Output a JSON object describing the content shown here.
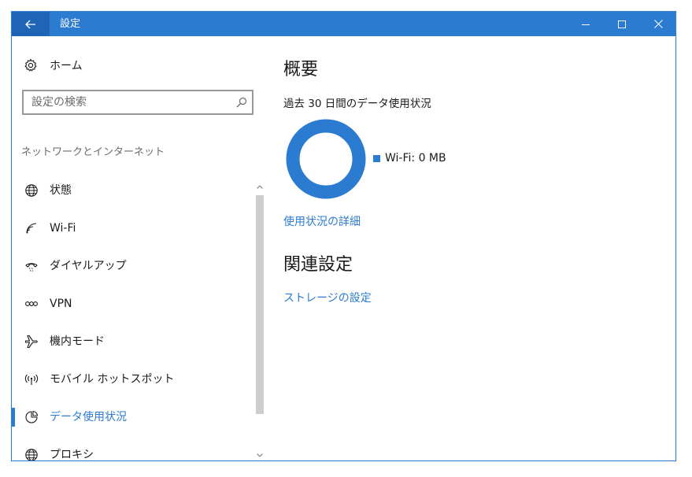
{
  "window": {
    "title": "設定",
    "accent_color": "#2b7bd0"
  },
  "sidebar": {
    "home_label": "ホーム",
    "search_placeholder": "設定の検索",
    "section_label": "ネットワークとインターネット",
    "items": [
      {
        "label": "状態",
        "icon": "globe-status-icon"
      },
      {
        "label": "Wi-Fi",
        "icon": "wifi-icon"
      },
      {
        "label": "ダイヤルアップ",
        "icon": "dialup-icon"
      },
      {
        "label": "VPN",
        "icon": "vpn-icon"
      },
      {
        "label": "機内モード",
        "icon": "airplane-icon"
      },
      {
        "label": "モバイル ホットスポット",
        "icon": "hotspot-icon"
      },
      {
        "label": "データ使用状況",
        "icon": "data-usage-icon",
        "active": true
      },
      {
        "label": "プロキシ",
        "icon": "globe-icon"
      }
    ]
  },
  "main": {
    "heading": "概要",
    "subtext": "過去 30 日間のデータ使用状況",
    "legend_label": "Wi-Fi: 0 MB",
    "usage_details_link": "使用状況の詳細",
    "related_heading": "関連設定",
    "storage_link": "ストレージの設定"
  }
}
